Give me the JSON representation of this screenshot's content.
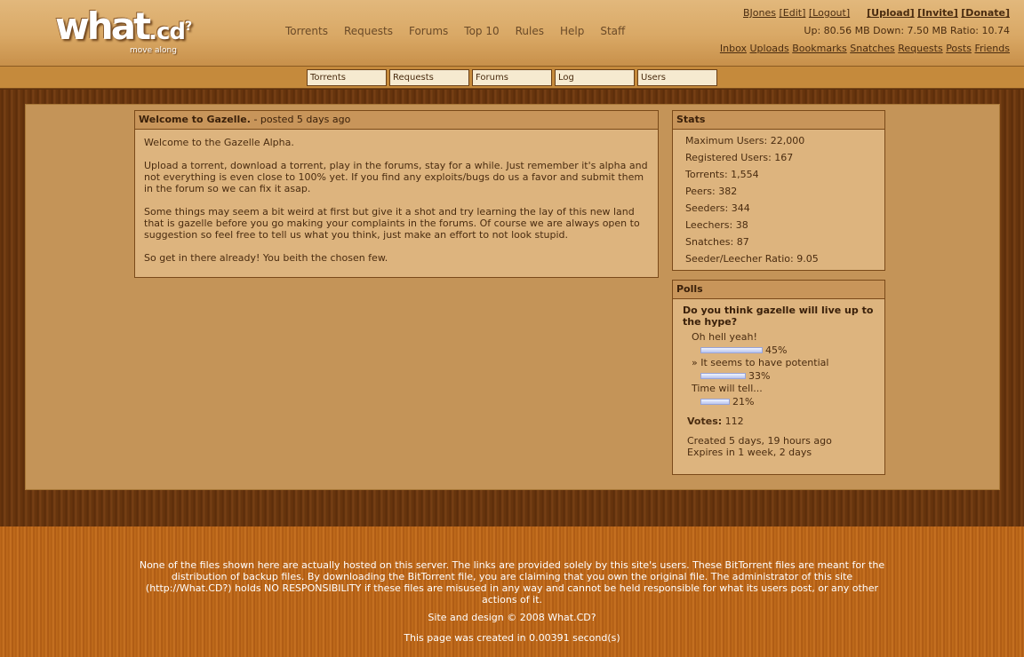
{
  "logo": {
    "word": "what",
    "suffix": ".cd",
    "super": "?",
    "tagline": "move along"
  },
  "nav": [
    "Torrents",
    "Requests",
    "Forums",
    "Top 10",
    "Rules",
    "Help",
    "Staff"
  ],
  "user": {
    "name": "BJones",
    "edit": "[Edit]",
    "logout": "[Logout]",
    "upload": "[Upload]",
    "invite": "[Invite]",
    "donate": "[Donate]",
    "stats": "Up: 80.56 MB Down: 7.50 MB Ratio: 10.74",
    "links": [
      "Inbox",
      "Uploads",
      "Bookmarks",
      "Snatches",
      "Requests",
      "Posts",
      "Friends"
    ]
  },
  "search": [
    "Torrents",
    "Requests",
    "Forums",
    "Log",
    "Users"
  ],
  "news": {
    "title": "Welcome to Gazelle.",
    "posted": " - posted 5 days ago",
    "paragraphs": [
      "Welcome to the Gazelle Alpha.",
      "Upload a torrent, download a torrent, play in the forums, stay for a while. Just remember it's alpha and not everything is even close to 100% yet. If you find any exploits/bugs do us a favor and submit them in the forum so we can fix it asap.",
      "Some things may seem a bit weird at first but give it a shot and try learning the lay of this new land that is gazelle before you go making your complaints in the forums. Of course we are always open to suggestion so feel free to tell us what you think, just make an effort to not look stupid.",
      "So get in there already! You beith the chosen few."
    ]
  },
  "stats": {
    "title": "Stats",
    "items": [
      "Maximum Users: 22,000",
      "Registered Users: 167",
      "Torrents: 1,554",
      "Peers: 382",
      "Seeders: 344",
      "Leechers: 38",
      "Snatches: 87",
      "Seeder/Leecher Ratio: 9.05"
    ]
  },
  "poll": {
    "title": "Polls",
    "question": "Do you think gazelle will live up to the hype?",
    "options": [
      {
        "label": "Oh hell yeah!",
        "pct": "45%",
        "value": 45
      },
      {
        "label": "» It seems to have potential",
        "pct": "33%",
        "value": 33
      },
      {
        "label": "Time will tell...",
        "pct": "21%",
        "value": 21
      }
    ],
    "votes_label": "Votes:",
    "votes": "112",
    "created": "Created 5 days, 19 hours ago",
    "expires": "Expires in 1 week, 2 days"
  },
  "footer": {
    "disclaimer": "None of the files shown here are actually hosted on this server. The links are provided solely by this site's users. These BitTorrent files are meant for the distribution of backup files. By downloading the BitTorrent file, you are claiming that you own the original file. The administrator of this site (http://What.CD?) holds NO RESPONSIBILITY if these files are misused in any way and cannot be held responsible for what its users post, or any other actions of it.",
    "copyright": "Site and design © 2008 What.CD?",
    "timing": "This page was created in 0.00391 second(s)"
  }
}
